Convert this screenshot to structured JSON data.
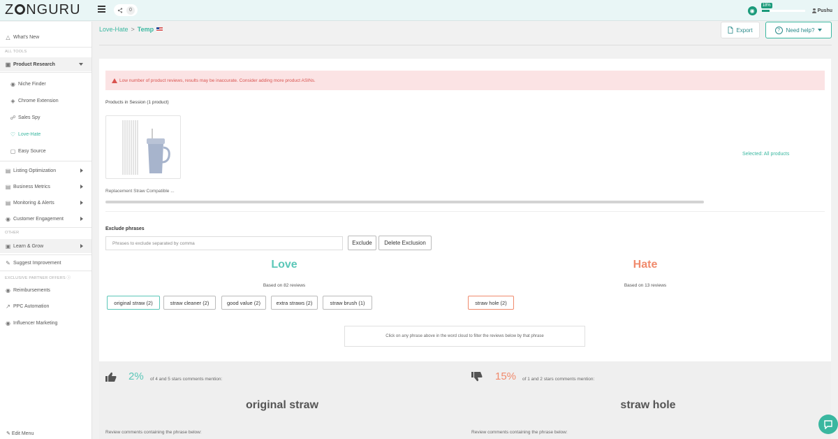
{
  "topbar": {
    "logo_pre": "Z",
    "logo_post": "NGURU",
    "share_count": "0",
    "progress_label": "18%",
    "progress_fraction": 0.18,
    "user": "Pushu"
  },
  "sidebar": {
    "whats_new": "What's New",
    "all_tools": "ALL TOOLS",
    "product_research": "Product Research",
    "niche_finder": "Niche Finder",
    "chrome_extension": "Chrome Extension",
    "sales_spy": "Sales Spy",
    "love_hate": "Love-Hate",
    "easy_source": "Easy Source",
    "listing_optimization": "Listing Optimization",
    "business_metrics": "Business Metrics",
    "monitoring_alerts": "Monitoring & Alerts",
    "customer_engagement": "Customer Engagement",
    "other": "OTHER",
    "learn_grow": "Learn & Grow",
    "suggest_improvement": "Suggest Improvement",
    "partner_offers": "EXCLUSIVE PARTNER OFFERS",
    "reimbursements": "Reimbursements",
    "ppc_automation": "PPC Automation",
    "influencer_marketing": "Influencer Marketing",
    "edit_menu": "Edit Menu"
  },
  "header": {
    "crumb_parent": "Love-Hate",
    "crumb_sep": ">",
    "crumb_current": "Temp",
    "export_label": "Export",
    "help_label": "Need help?"
  },
  "main": {
    "alert": "Low number of product reviews, results may be inaccurate. Consider adding more product ASINs.",
    "session_label": "Products in Session (1 product)",
    "product_name": "Replacement Straw Compatible ...",
    "selected_label": "Selected: All products",
    "exclude_label": "Exclude phrases",
    "exclude_placeholder": "Phrases to exclude separated by comma",
    "exclude_button": "Exclude",
    "delete_exclusion_button": "Delete Exclusion",
    "love_title": "Love",
    "love_sub": "Based on 82 reviews",
    "hate_title": "Hate",
    "hate_sub": "Based on 13 reviews",
    "love_chips": [
      "original straw (2)",
      "straw cleaner (2)",
      "good value (2)",
      "extra straws (2)",
      "straw brush (1)"
    ],
    "hate_chips": [
      "straw hole (2)"
    ],
    "hint": "Click on any phrase above in the word cloud to filter the reviews below by that phrase"
  },
  "bottom": {
    "love_pct": "2%",
    "love_desc": "of 4 and 5 stars comments mention:",
    "love_phrase": "original straw",
    "hate_pct": "15%",
    "hate_desc": "of 1 and 2 stars comments mention:",
    "hate_phrase": "straw hole",
    "review_comments_label": "Review comments containing the phrase below:"
  },
  "colors": {
    "accent": "#3ab7a0",
    "love": "#5bc7b8",
    "hate": "#f08a6c",
    "alert_bg": "#fbe3e4",
    "alert_text": "#d9534f"
  }
}
